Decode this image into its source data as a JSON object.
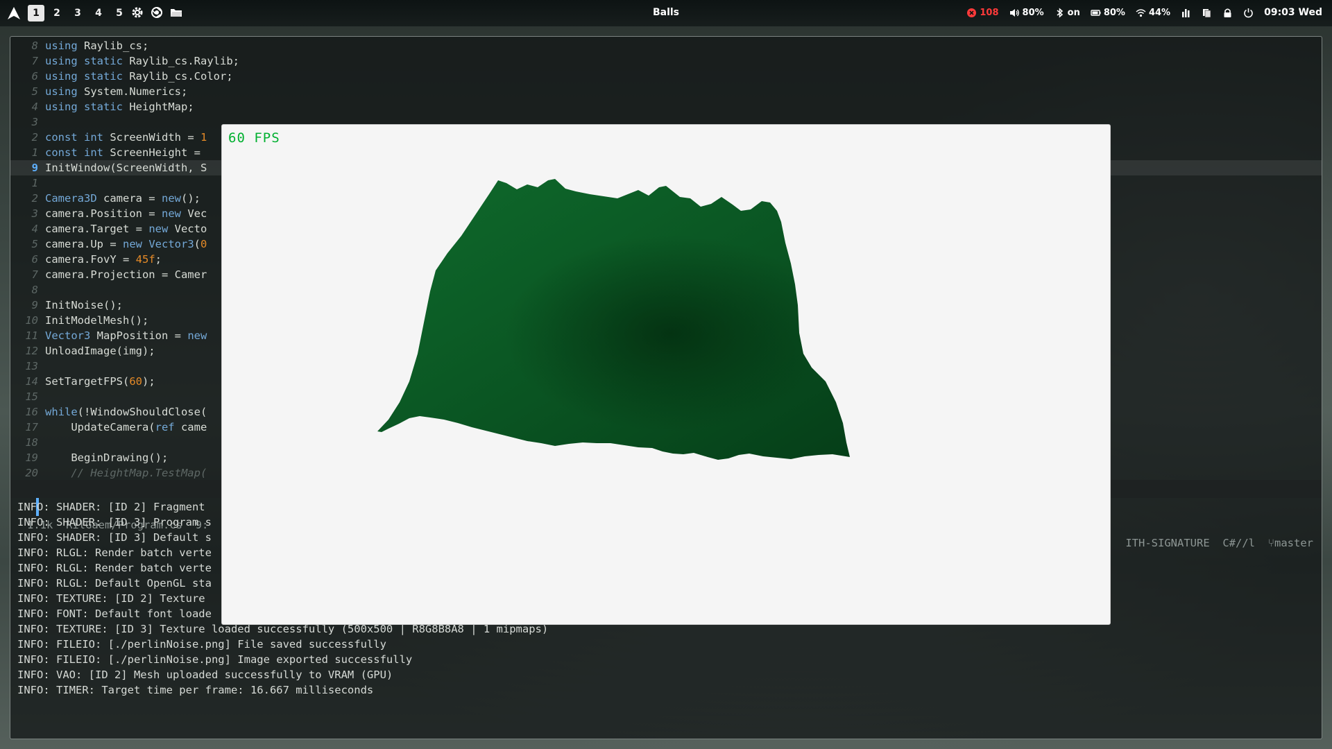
{
  "topbar": {
    "workspaces": [
      "1",
      "2",
      "3",
      "4",
      "5"
    ],
    "active_workspace": "1",
    "icons": [
      "settings-icon",
      "browser-icon",
      "folder-icon"
    ],
    "window_title": "Balls",
    "status": {
      "alerts": "108",
      "volume": "80%",
      "bluetooth": "on",
      "battery": "80%",
      "wifi": "44%",
      "clock": "09:03 Wed"
    }
  },
  "editor": {
    "lines": [
      {
        "num": "8",
        "text": "using Raylib_cs;"
      },
      {
        "num": "7",
        "text": "using static Raylib_cs.Raylib;"
      },
      {
        "num": "6",
        "text": "using static Raylib_cs.Color;"
      },
      {
        "num": "5",
        "text": "using System.Numerics;"
      },
      {
        "num": "4",
        "text": "using static HeightMap;"
      },
      {
        "num": "3",
        "text": ""
      },
      {
        "num": "2",
        "text": "const int ScreenWidth = 1"
      },
      {
        "num": "1",
        "text": "const int ScreenHeight ="
      },
      {
        "num": "9",
        "text": "InitWindow(ScreenWidth, S"
      },
      {
        "num": "1",
        "text": ""
      },
      {
        "num": "2",
        "text": "Camera3D camera = new();"
      },
      {
        "num": "3",
        "text": "camera.Position = new Vec"
      },
      {
        "num": "4",
        "text": "camera.Target = new Vecto"
      },
      {
        "num": "5",
        "text": "camera.Up = new Vector3(0"
      },
      {
        "num": "6",
        "text": "camera.FovY = 45f;"
      },
      {
        "num": "7",
        "text": "camera.Projection = Camer"
      },
      {
        "num": "8",
        "text": ""
      },
      {
        "num": "9",
        "text": "InitNoise();"
      },
      {
        "num": "10",
        "text": "InitModelMesh();"
      },
      {
        "num": "11",
        "text": "Vector3 MapPosition = new"
      },
      {
        "num": "12",
        "text": "UnloadImage(img);"
      },
      {
        "num": "13",
        "text": ""
      },
      {
        "num": "14",
        "text": "SetTargetFPS(60);"
      },
      {
        "num": "15",
        "text": ""
      },
      {
        "num": "16",
        "text": "while(!WindowShouldClose("
      },
      {
        "num": "17",
        "text": "    UpdateCamera(ref came"
      },
      {
        "num": "18",
        "text": ""
      },
      {
        "num": "19",
        "text": "    BeginDrawing();"
      },
      {
        "num": "20",
        "text": "    // HeightMap.TestMap("
      }
    ],
    "current_line_index": 8
  },
  "statusline": {
    "size": "1.1k",
    "file": "RilGaem/Program.cs",
    "position": "9:",
    "encoding": "ITH-SIGNATURE",
    "filetype": "C#//l",
    "branch": "master"
  },
  "log": [
    "INFO: SHADER: [ID 2] Fragment",
    "INFO: SHADER: [ID 3] Program s",
    "INFO: SHADER: [ID 3] Default s",
    "INFO: RLGL: Render batch verte",
    "INFO: RLGL: Render batch verte",
    "INFO: RLGL: Default OpenGL sta",
    "INFO: TEXTURE: [ID 2] Texture",
    "INFO: FONT: Default font loade",
    "INFO: TEXTURE: [ID 3] Texture loaded successfully (500x500 | R8G8B8A8 | 1 mipmaps)",
    "INFO: FILEIO: [./perlinNoise.png] File saved successfully",
    "INFO: FILEIO: [./perlinNoise.png] Image exported successfully",
    "INFO: VAO: [ID 2] Mesh uploaded successfully to VRAM (GPU)",
    "INFO: TIMER: Target time per frame: 16.667 milliseconds"
  ],
  "game": {
    "fps_text": "60 FPS",
    "terrain_color": "#0b5e26",
    "background_color": "#f5f5f5",
    "fps_color": "#00b030"
  }
}
